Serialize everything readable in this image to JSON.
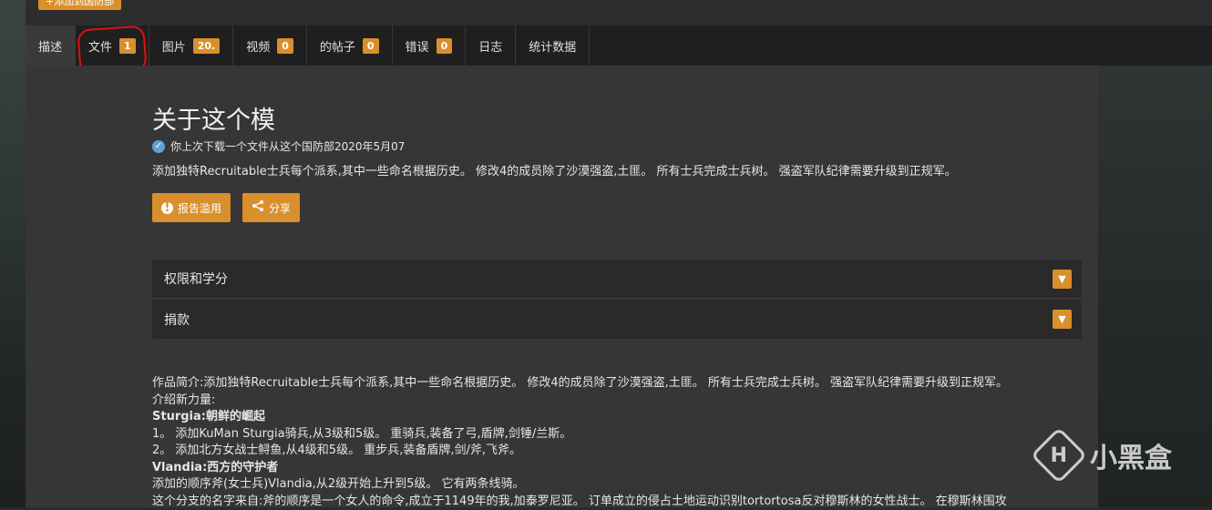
{
  "top_button": "+添加到国防部",
  "tabs": [
    {
      "label": "描述",
      "badge": null
    },
    {
      "label": "文件",
      "badge": "1"
    },
    {
      "label": "图片",
      "badge": "20."
    },
    {
      "label": "视频",
      "badge": "0"
    },
    {
      "label": "的帖子",
      "badge": "0"
    },
    {
      "label": "错误",
      "badge": "0"
    },
    {
      "label": "日志",
      "badge": null
    },
    {
      "label": "统计数据",
      "badge": null
    }
  ],
  "title": "关于这个模",
  "download_notice": "你上次下载一个文件从这个国防部2020年5月07",
  "summary": "添加独特Recruitable士兵每个派系,其中一些命名根据历史。 修改4的成员除了沙漠强盗,土匪。 所有士兵完成士兵树。 强盗军队纪律需要升级到正规军。",
  "buttons": {
    "report": "报告滥用",
    "share": "分享"
  },
  "accordions": [
    {
      "label": "权限和学分"
    },
    {
      "label": "捐款"
    }
  ],
  "body_lines": [
    "作品简介:添加独特Recruitable士兵每个派系,其中一些命名根据历史。 修改4的成员除了沙漠强盗,土匪。 所有士兵完成士兵树。 强盗军队纪律需要升级到正规军。",
    "介绍新力量:",
    "Sturgia:朝鲜的崛起",
    "1。 添加KuMan Sturgia骑兵,从3级和5级。 重骑兵,装备了弓,盾牌,剑锤/兰斯。",
    "2。 添加北方女战士鲟鱼,从4级和5级。 重步兵,装备盾牌,剑/斧,飞斧。",
    "Vlandia:西方的守护者",
    "添加的顺序斧(女士兵)Vlandia,从2级开始上升到5级。 它有两条线骑。",
    "这个分支的名字来自:斧的顺序是一个女人的命令,成立于1149年的我,加泰罗尼亚。 订单成立的侵占土地运动识别tortortosa反对穆斯林的女性战士。 在穆斯林围攻"
  ],
  "watermark": "小黑盒",
  "colors": {
    "accent": "#d98f2b",
    "tabbar": "#1f1f1f",
    "content": "#363636",
    "accordion": "#2a2a2a"
  }
}
